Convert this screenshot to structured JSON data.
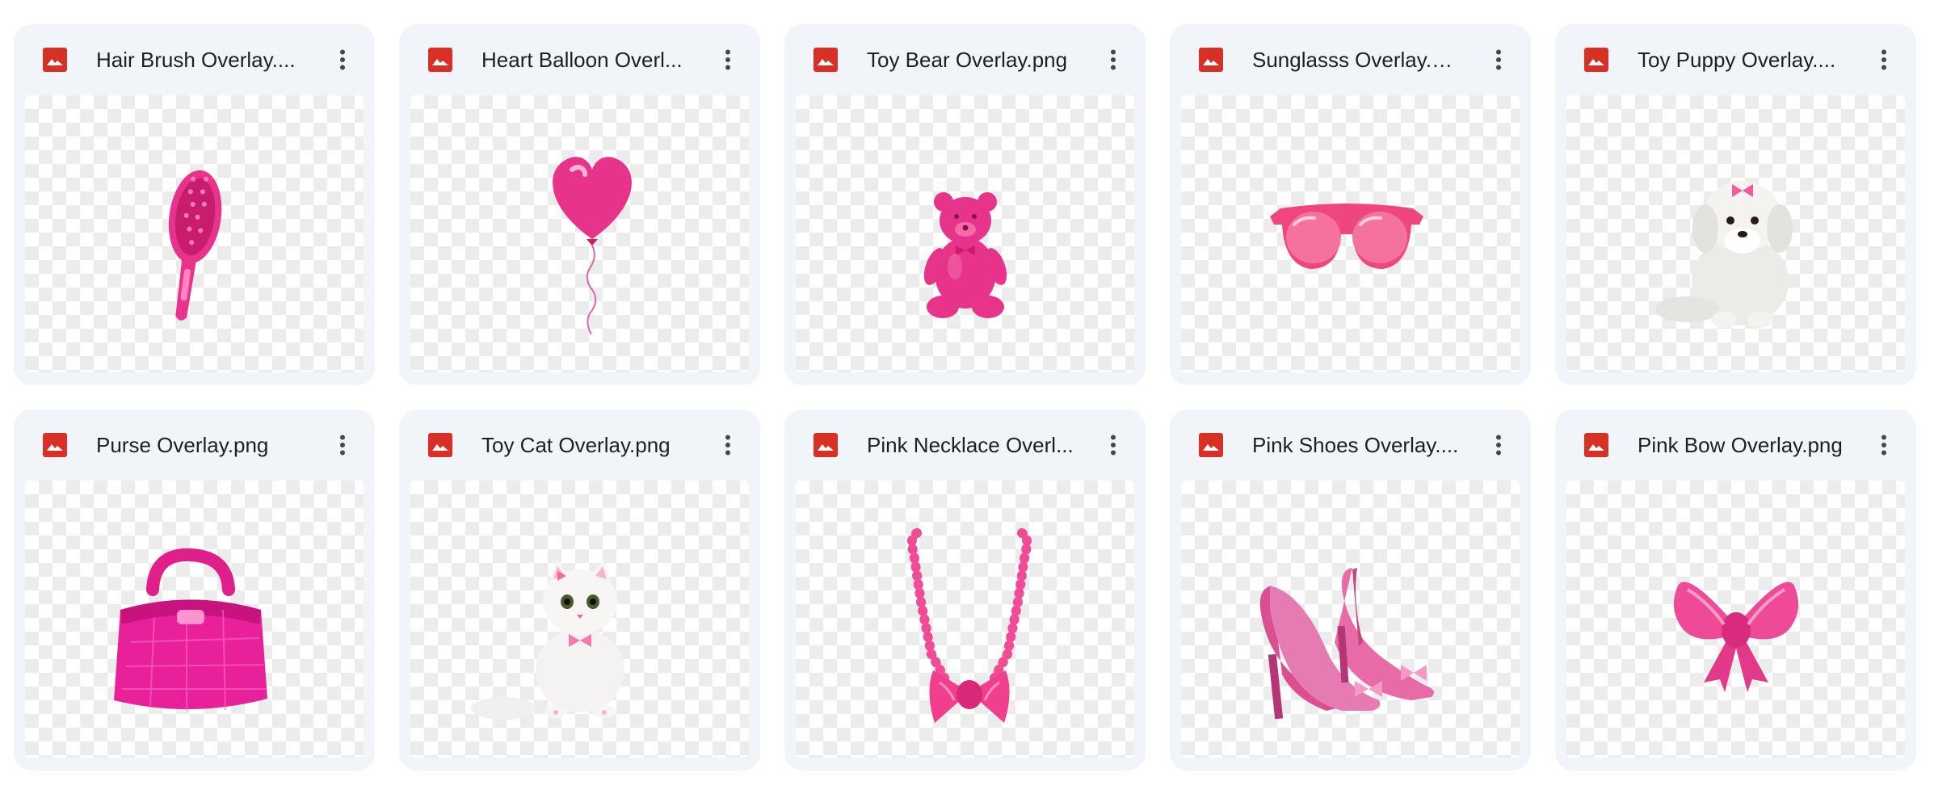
{
  "files": [
    {
      "name": "Hair Brush Overlay....",
      "icon": "image-file-icon",
      "thumbnail": "hair-brush"
    },
    {
      "name": "Heart Balloon Overl...",
      "icon": "image-file-icon",
      "thumbnail": "heart-balloon"
    },
    {
      "name": "Toy Bear Overlay.png",
      "icon": "image-file-icon",
      "thumbnail": "toy-bear"
    },
    {
      "name": "Sunglasss Overlay.p...",
      "icon": "image-file-icon",
      "thumbnail": "sunglasses"
    },
    {
      "name": "Toy Puppy Overlay....",
      "icon": "image-file-icon",
      "thumbnail": "toy-puppy"
    },
    {
      "name": "Purse Overlay.png",
      "icon": "image-file-icon",
      "thumbnail": "purse"
    },
    {
      "name": "Toy Cat Overlay.png",
      "icon": "image-file-icon",
      "thumbnail": "toy-cat"
    },
    {
      "name": "Pink Necklace Overl...",
      "icon": "image-file-icon",
      "thumbnail": "pink-necklace"
    },
    {
      "name": "Pink Shoes Overlay....",
      "icon": "image-file-icon",
      "thumbnail": "pink-shoes"
    },
    {
      "name": "Pink Bow Overlay.png",
      "icon": "image-file-icon",
      "thumbnail": "pink-bow"
    }
  ],
  "colors": {
    "card_background": "#f1f4f9",
    "file_icon_red": "#d93025",
    "accent_pink": "#e8338a"
  }
}
